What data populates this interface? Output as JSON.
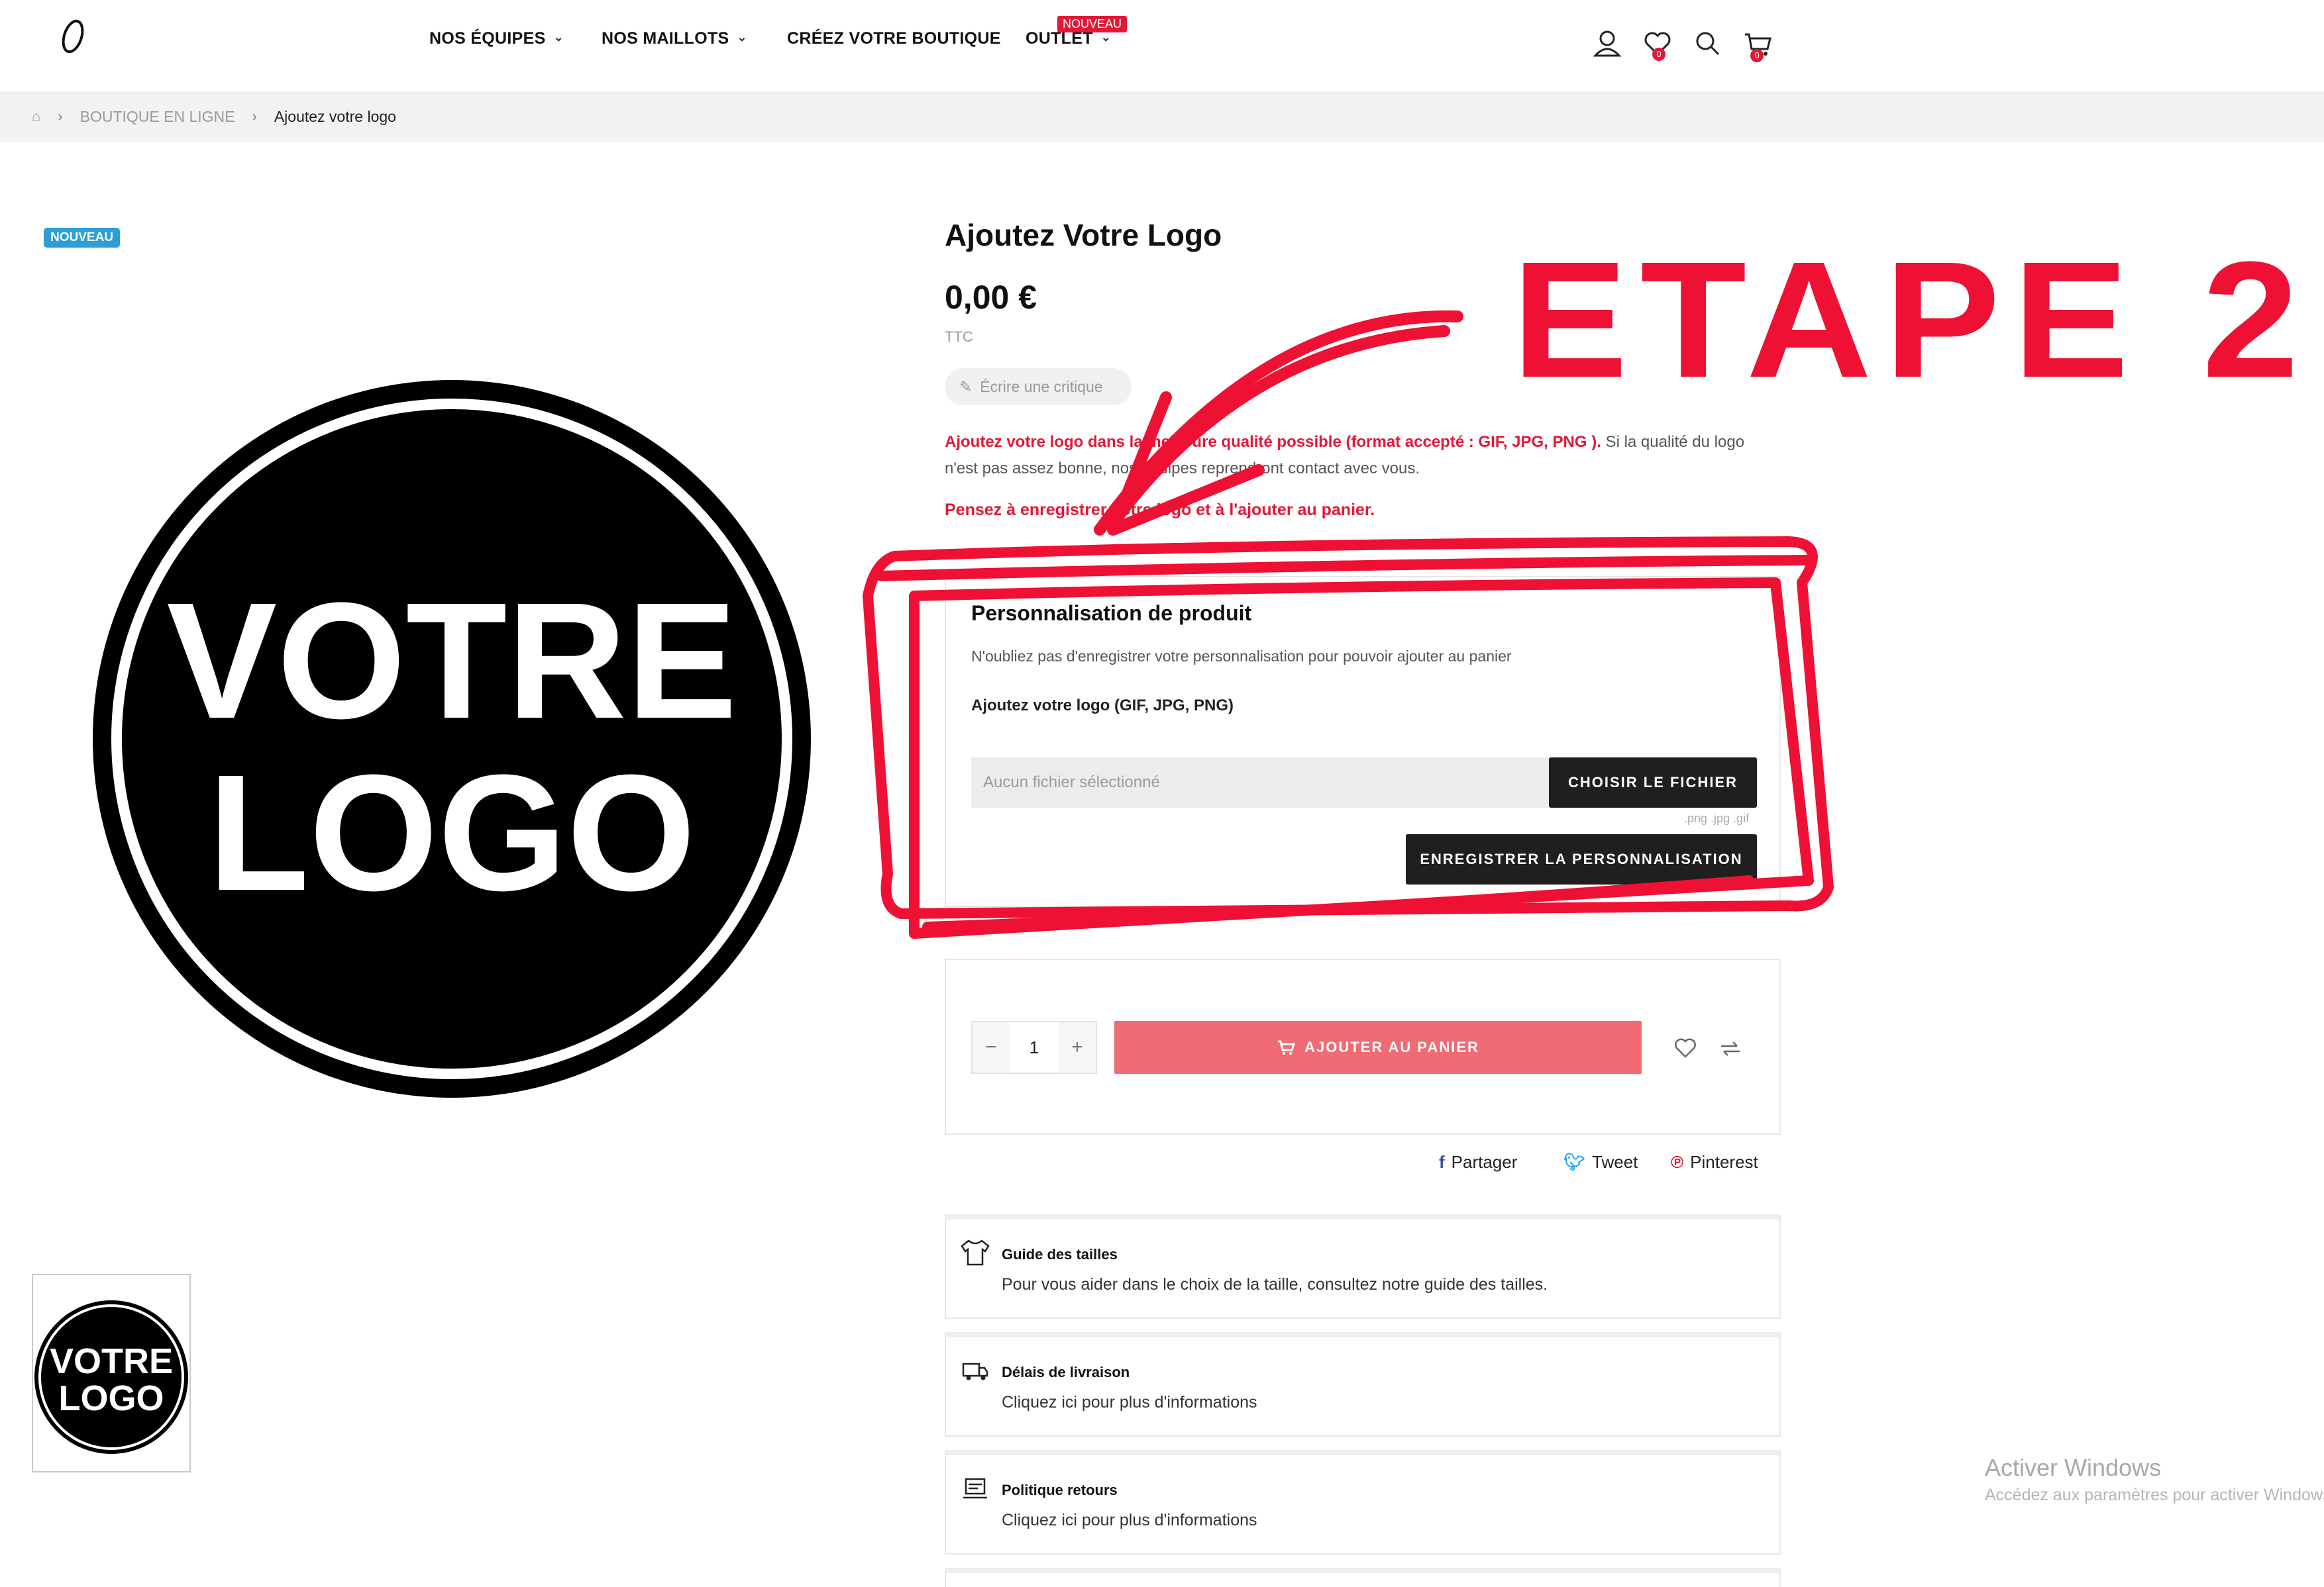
{
  "header": {
    "nav": [
      {
        "label": "NOS ÉQUIPES",
        "has_dropdown": true
      },
      {
        "label": "NOS MAILLOTS",
        "has_dropdown": true
      },
      {
        "label": "CRÉEZ VOTRE BOUTIQUE",
        "has_dropdown": false
      },
      {
        "label": "OUTLET",
        "has_dropdown": true
      }
    ],
    "outlet_badge": "NOUVEAU",
    "icons": [
      "user-icon",
      "heart-icon",
      "search-icon",
      "cart-icon"
    ],
    "wishlist_count": "0",
    "cart_count": "0"
  },
  "breadcrumb": {
    "home_icon": "home-icon",
    "items": [
      "BOUTIQUE EN LIGNE",
      "Ajoutez votre logo"
    ]
  },
  "gallery": {
    "badge": "NOUVEAU",
    "logo_line1": "VOTRE",
    "logo_line2": "LOGO"
  },
  "product": {
    "title": "Ajoutez Votre Logo",
    "price": "0,00 €",
    "tax_label": "TTC",
    "review_label": "Écrire une critique",
    "desc_red": "Ajoutez votre logo dans la meilleure qualité possible (format accepté : GIF, JPG, PNG ).",
    "desc_rest": " Si la qualité du logo n'est pas assez bonne, nos équipes reprendront contact avec vous.",
    "reminder": "Pensez à enregistrer votre logo et à l'ajouter au panier."
  },
  "customization": {
    "title": "Personnalisation de produit",
    "subtitle": "N'oubliez pas d'enregistrer votre personnalisation pour pouvoir ajouter au panier",
    "field_label": "Ajoutez votre logo (GIF, JPG, PNG)",
    "file_placeholder": "Aucun fichier sélectionné",
    "choose_button": "CHOISIR LE FICHIER",
    "extensions_hint": ".png .jpg .gif",
    "save_button": "ENREGISTRER LA PERSONNALISATION"
  },
  "cart": {
    "qty_minus": "−",
    "qty_value": "1",
    "qty_plus": "+",
    "add_button": "AJOUTER AU PANIER"
  },
  "share": {
    "facebook": "Partager",
    "twitter": "Tweet",
    "pinterest": "Pinterest"
  },
  "info_boxes": [
    {
      "title": "Guide des tailles",
      "text": "Pour vous aider dans le choix de la taille, consultez notre guide des tailles.",
      "icon": "tshirt-icon"
    },
    {
      "title": "Délais de livraison",
      "text": "Cliquez ici pour plus d'informations",
      "icon": "truck-icon"
    },
    {
      "title": "Politique retours",
      "text": "Cliquez ici pour plus d'informations",
      "icon": "return-icon"
    }
  ],
  "watermark": {
    "title": "Activer Windows",
    "subtitle": "Accédez aux paramètres pour activer Windows."
  },
  "annotation": {
    "label": "ETAPE 2",
    "color": "#ee1133"
  },
  "colors": {
    "accent_red": "#e31837",
    "cart_button": "#f06b73",
    "badge_blue": "#2a9fd8",
    "dark_button": "#1f1f1f"
  }
}
